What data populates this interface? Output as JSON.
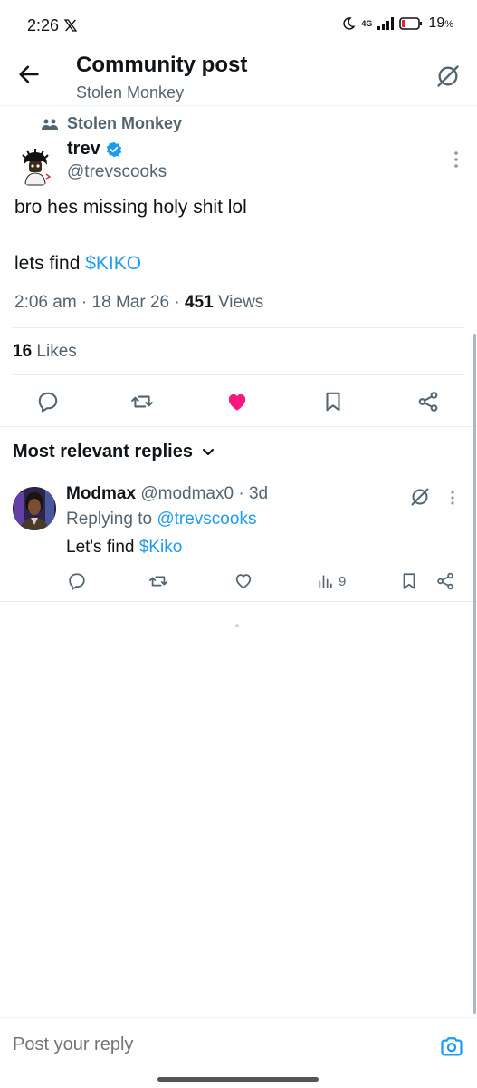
{
  "status_bar": {
    "time": "2:26",
    "network": "4G",
    "battery": "19",
    "battery_unit": "%"
  },
  "header": {
    "title": "Community post",
    "subtitle": "Stolen Monkey"
  },
  "post": {
    "community": "Stolen Monkey",
    "author_name": "trev",
    "author_handle": "@trevscooks",
    "line1": "bro hes missing holy shit lol",
    "line2_prefix": "lets find ",
    "line2_cashtag": "$KIKO",
    "time": "2:06 am",
    "date": "18 Mar 26",
    "views_count": "451",
    "views_label": "Views",
    "likes_count": "16",
    "likes_label": "Likes"
  },
  "replies_section": {
    "heading": "Most relevant replies"
  },
  "reply": {
    "author_name": "Modmax",
    "author_handle": "@modmax0",
    "age": "3d",
    "replying_prefix": "Replying to ",
    "replying_handle": "@trevscooks",
    "text_prefix": "Let's find ",
    "text_cashtag": "$Kiko",
    "views": "9"
  },
  "composer": {
    "placeholder": "Post your reply"
  },
  "colors": {
    "accent": "#1d9bf0",
    "like": "#f91880",
    "muted": "#536471"
  },
  "icons": [
    "back-arrow-icon",
    "grok-icon",
    "community-icon",
    "verified-badge-icon",
    "more-icon",
    "reply-icon",
    "repost-icon",
    "like-icon",
    "bookmark-icon",
    "share-icon",
    "chevron-down-icon",
    "views-icon",
    "camera-icon"
  ]
}
